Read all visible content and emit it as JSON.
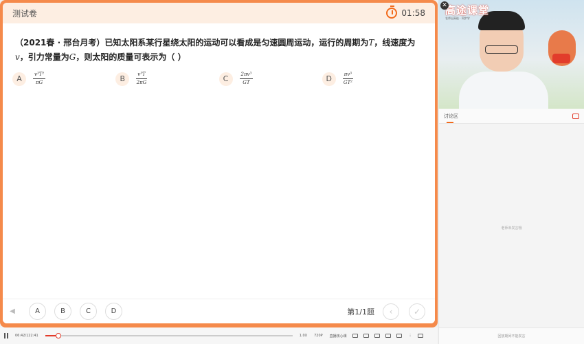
{
  "quiz": {
    "title": "测试卷",
    "timer": "01:58",
    "question": {
      "source": "（2021春 · 邢台月考）",
      "text_1": "已知太阳系某行星绕太阳的运动可以看成是匀速圆周运动，运行的周期为",
      "var_T": "T",
      "text_2": "，线速度为",
      "var_v": "v",
      "text_3": "，引力常量为",
      "var_G": "G",
      "text_4": "，则太阳的质量可表示为（   ）"
    },
    "options": [
      {
        "letter": "A",
        "num": "v³T²",
        "den": "πG"
      },
      {
        "letter": "B",
        "num": "v³T",
        "den": "2πG"
      },
      {
        "letter": "C",
        "num": "2πv³",
        "den": "GT"
      },
      {
        "letter": "D",
        "num": "πv³",
        "den": "GT²"
      }
    ],
    "footer": {
      "answers": [
        "A",
        "B",
        "C",
        "D"
      ],
      "page": "第1/1题"
    }
  },
  "video": {
    "logo": "高途课堂",
    "logo_sub": "名师出高徒 · 同步学"
  },
  "chat": {
    "title": "讨论区",
    "empty": "老师未发言哦",
    "input_placeholder": "回放期间不能发言"
  },
  "player": {
    "time": "06:42/122:41",
    "progress": 0.055,
    "speed": "1.0X",
    "quality": "720P",
    "live_label": "直播核心课"
  },
  "colors": {
    "accent": "#f58a4b",
    "brand_red": "#e23c2b"
  }
}
